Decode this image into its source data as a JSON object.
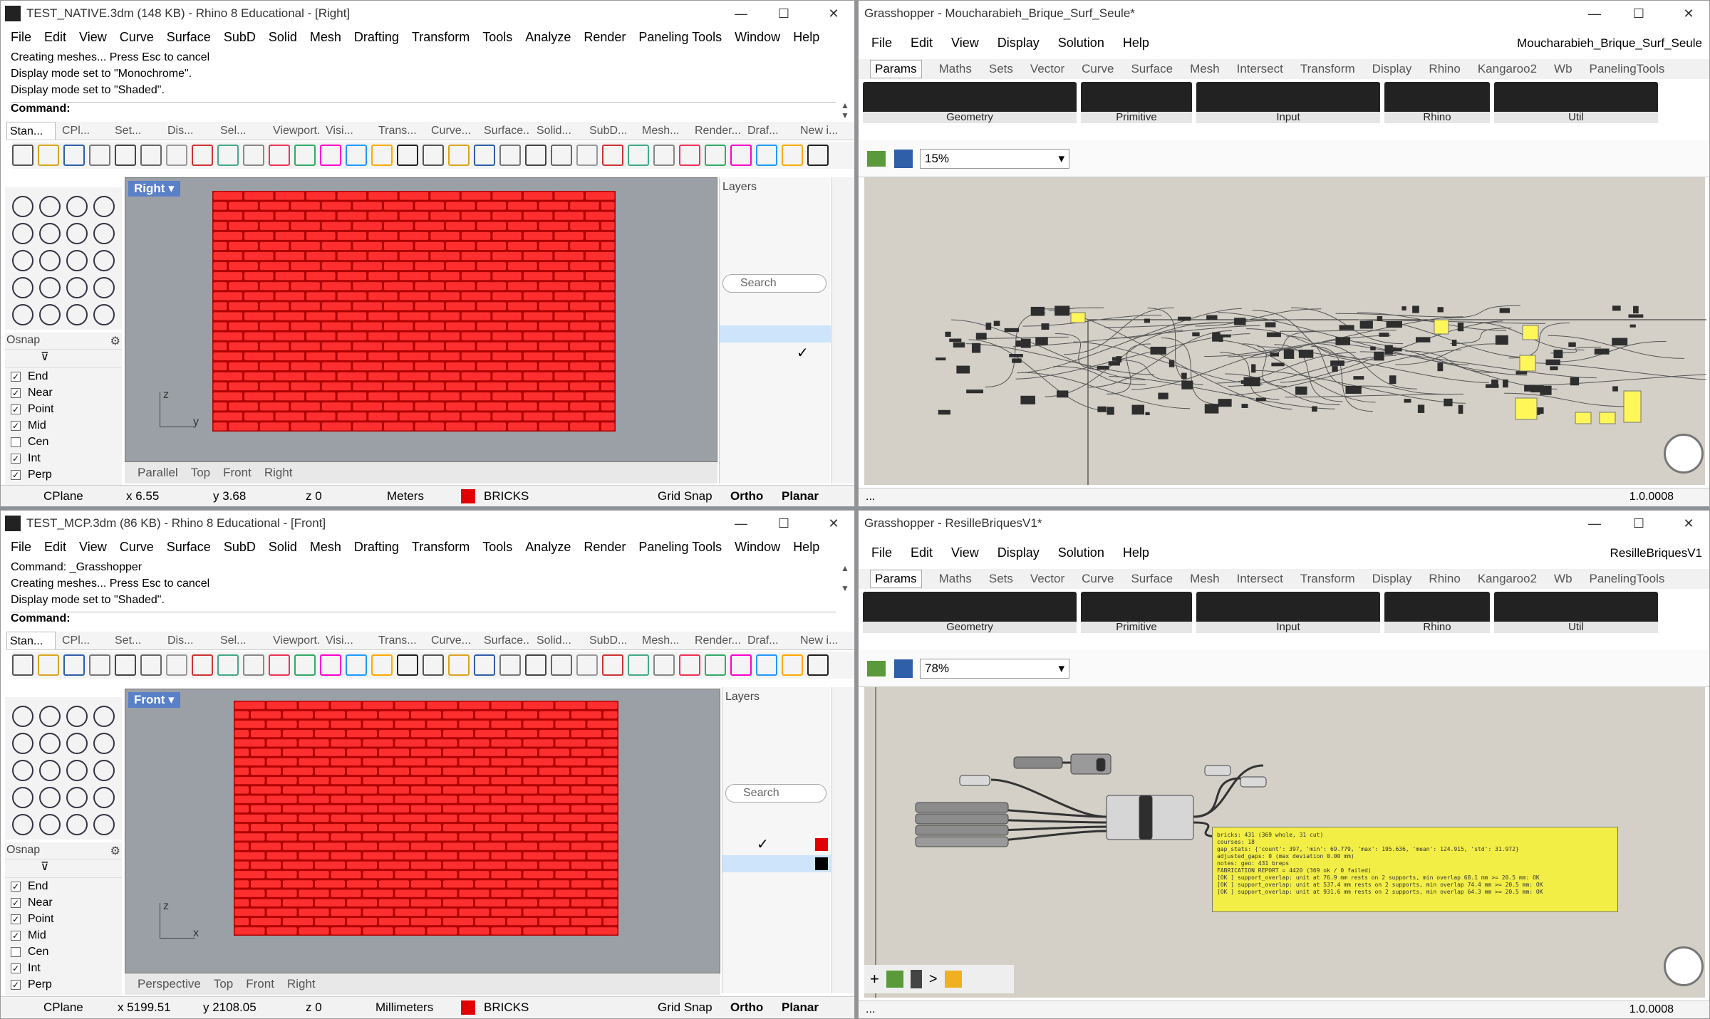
{
  "rhino_top": {
    "title": "TEST_NATIVE.3dm (148 KB) - Rhino 8 Educational - [Right]",
    "menu": [
      "File",
      "Edit",
      "View",
      "Curve",
      "Surface",
      "SubD",
      "Solid",
      "Mesh",
      "Drafting",
      "Transform",
      "Tools",
      "Analyze",
      "Render",
      "Paneling Tools",
      "Window",
      "Help"
    ],
    "history": [
      "Creating meshes... Press Esc to cancel",
      "Display mode set to \"Monochrome\".",
      "Display mode set to \"Shaded\"."
    ],
    "command_label": "Command:",
    "tabs": [
      "Stan...",
      "CPl...",
      "Set...",
      "Dis...",
      "Sel...",
      "Viewport...",
      "Visi...",
      "Trans...",
      "Curve...",
      "Surface...",
      "Solid...",
      "SubD...",
      "Mesh...",
      "Render...",
      "Draf...",
      "New i..."
    ],
    "viewport_label": "Right",
    "axis_v": "z",
    "axis_h": "y",
    "vtabs": [
      "Parallel",
      "Top",
      "Front",
      "Right"
    ],
    "layers_title": "Layers",
    "search": "Search",
    "osnap": "Osnap",
    "status": {
      "cplane": "CPlane",
      "x": "x 6.55",
      "y": "y 3.68",
      "z": "z 0",
      "units": "Meters",
      "layer": "BRICKS",
      "grid": "Grid Snap",
      "ortho": "Ortho",
      "planar": "Planar"
    }
  },
  "rhino_bottom": {
    "title": "TEST_MCP.3dm (86 KB) - Rhino 8 Educational - [Front]",
    "menu": [
      "File",
      "Edit",
      "View",
      "Curve",
      "Surface",
      "SubD",
      "Solid",
      "Mesh",
      "Drafting",
      "Transform",
      "Tools",
      "Analyze",
      "Render",
      "Paneling Tools",
      "Window",
      "Help"
    ],
    "history": [
      "Command: _Grasshopper",
      "Creating meshes... Press Esc to cancel",
      "Display mode set to \"Shaded\"."
    ],
    "command_label": "Command:",
    "tabs": [
      "Stan...",
      "CPl...",
      "Set...",
      "Dis...",
      "Sel...",
      "Viewport...",
      "Visi...",
      "Trans...",
      "Curve...",
      "Surface...",
      "Solid...",
      "SubD...",
      "Mesh...",
      "Render...",
      "Draf...",
      "New i..."
    ],
    "viewport_label": "Front",
    "axis_v": "z",
    "axis_h": "x",
    "vtabs": [
      "Perspective",
      "Top",
      "Front",
      "Right"
    ],
    "layers_title": "Layers",
    "search": "Search",
    "osnap": "Osnap",
    "status": {
      "cplane": "CPlane",
      "x": "x 5199.51",
      "y": "y 2108.05",
      "z": "z 0",
      "units": "Millimeters",
      "layer": "BRICKS",
      "grid": "Grid Snap",
      "ortho": "Ortho",
      "planar": "Planar"
    }
  },
  "osnap_items": [
    {
      "label": "End",
      "checked": true
    },
    {
      "label": "Near",
      "checked": true
    },
    {
      "label": "Point",
      "checked": true
    },
    {
      "label": "Mid",
      "checked": true
    },
    {
      "label": "Cen",
      "checked": false
    },
    {
      "label": "Int",
      "checked": true
    },
    {
      "label": "Perp",
      "checked": true
    }
  ],
  "gh_top": {
    "title": "Grasshopper - Moucharabieh_Brique_Surf_Seule*",
    "doc_name": "Moucharabieh_Brique_Surf_Seule",
    "menu": [
      "File",
      "Edit",
      "View",
      "Display",
      "Solution",
      "Help"
    ],
    "ribbon": [
      "Params",
      "Maths",
      "Sets",
      "Vector",
      "Curve",
      "Surface",
      "Mesh",
      "Intersect",
      "Transform",
      "Display",
      "Rhino",
      "Kangaroo2",
      "Wb",
      "PanelingTools"
    ],
    "groups": [
      "Geometry",
      "Primitive",
      "Input",
      "Rhino",
      "Util"
    ],
    "zoom": "15%",
    "version": "1.0.0008",
    "status_left": "..."
  },
  "gh_bottom": {
    "title": "Grasshopper - ResilleBriquesV1*",
    "doc_name": "ResilleBriquesV1",
    "menu": [
      "File",
      "Edit",
      "View",
      "Display",
      "Solution",
      "Help"
    ],
    "ribbon": [
      "Params",
      "Maths",
      "Sets",
      "Vector",
      "Curve",
      "Surface",
      "Mesh",
      "Intersect",
      "Transform",
      "Display",
      "Rhino",
      "Kangaroo2",
      "Wb",
      "PanelingTools"
    ],
    "groups": [
      "Geometry",
      "Primitive",
      "Input",
      "Rhino",
      "Util"
    ],
    "zoom": "78%",
    "version": "1.0.0008",
    "status_left": "...",
    "panel_lines": [
      "bricks: 431 (369 whole, 31 cut)",
      "courses: 18",
      "gap_stats: {'count': 397, 'min': 69.779, 'max': 195.636, 'mean': 124.915, 'std': 31.972}",
      "adjusted_gaps: 0 (max deviation 0.00 mm)",
      "notes: geo: 431 breps",
      "",
      "FABRICATION REPORT = 4420 (369 ok / 0 failed)",
      "",
      "[OK ] support_overlap: unit at 76.9 mm rests on 2 supports, min overlap 68.1 mm >= 20.5 mm: OK",
      "[OK ] support_overlap: unit at 537.4 mm rests on 2 supports, min overlap 74.4 mm >= 20.5 mm: OK",
      "[OK ] support_overlap: unit at 931.6 mm rests on 2 supports, min overlap 64.3 mm >= 20.5 mm: OK"
    ]
  },
  "colors": {
    "brick": "#ff2f2f",
    "brick_edge": "#b00000",
    "viewport": "#9ba0a6",
    "gh_canvas": "#d4d0c8",
    "panel": "#f3ee46",
    "accent": "#5a80c8"
  },
  "wall_top": {
    "rows": 24,
    "cols": 13
  },
  "wall_bottom": {
    "rows": 25,
    "cols": 12
  }
}
